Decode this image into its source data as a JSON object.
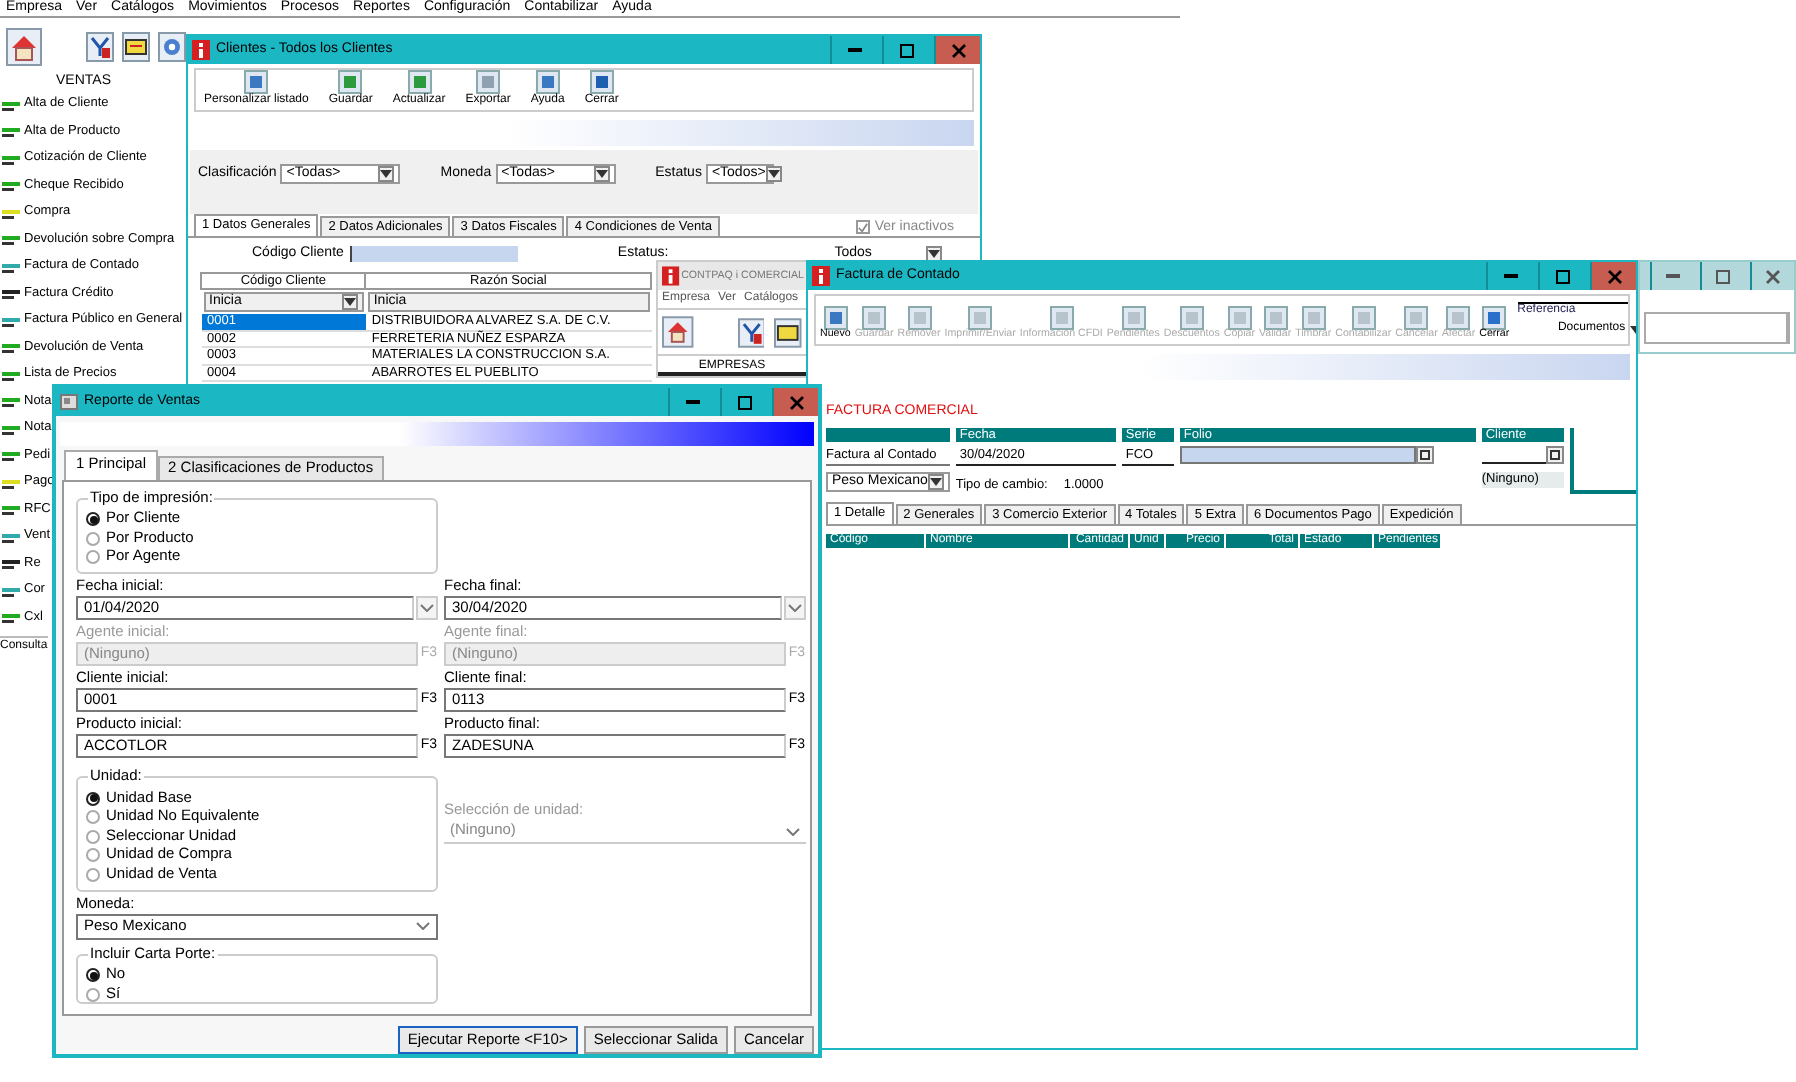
{
  "menu_bar": [
    "Empresa",
    "Ver",
    "Catálogos",
    "Movimientos",
    "Procesos",
    "Reportes",
    "Configuración",
    "Contabilizar",
    "Ayuda"
  ],
  "sidebar": {
    "title": "VENTAS",
    "items": [
      "Alta de Cliente",
      "Alta de Producto",
      "Cotización de Cliente",
      "Cheque Recibido",
      "Compra",
      "Devolución sobre Compra",
      "Factura de Contado",
      "Factura Crédito",
      "Factura Público en General",
      "Devolución de Venta",
      "Lista de Precios",
      "Nota",
      "Nota",
      "Pedi",
      "Pago",
      "RFC",
      "Vent",
      "Re",
      "Cor",
      "Cxl"
    ],
    "footer": "Consulta"
  },
  "clientes_window": {
    "title": "Clientes - Todos los Clientes",
    "toolbar": [
      "Personalizar listado",
      "Guardar",
      "Actualizar",
      "Exportar",
      "Ayuda",
      "Cerrar"
    ],
    "filters": [
      {
        "label": "Clasificación",
        "value": "<Todas>"
      },
      {
        "label": "Moneda",
        "value": "<Todas>"
      },
      {
        "label": "Estatus",
        "value": "<Todos>"
      }
    ],
    "tabs": [
      {
        "label": "1 Datos Generales",
        "selected": true
      },
      {
        "label": "2 Datos Adicionales",
        "selected": false
      },
      {
        "label": "3 Datos Fiscales",
        "selected": false
      },
      {
        "label": "4 Condiciones de Venta",
        "selected": false
      }
    ],
    "code_label": "Código Cliente",
    "status_label": "Estatus:",
    "status_value": "Todos",
    "inactive": {
      "label": "Ver inactivos",
      "checked": true
    },
    "table": {
      "columns": [
        "Código Cliente",
        "Razón Social"
      ],
      "filters": [
        "Inicia",
        "Inicia"
      ],
      "rows": [
        {
          "cells": [
            "0001",
            "DISTRIBUIDORA ALVAREZ S.A. DE C.V."
          ],
          "selected": true
        },
        {
          "cells": [
            "0002",
            "FERRETERIA NUÑEZ ESPARZA"
          ],
          "selected": false
        },
        {
          "cells": [
            "0003",
            "MATERIALES LA CONSTRUCCION S.A."
          ],
          "selected": false
        },
        {
          "cells": [
            "0004",
            "ABARROTES EL PUEBLITO"
          ],
          "selected": false
        }
      ]
    }
  },
  "contpaq_window": {
    "title": "CONTPAQ i COMERCIAL",
    "menu": [
      "Empresa",
      "Ver",
      "Catálogos"
    ],
    "label": "EMPRESAS"
  },
  "factura_window": {
    "title": "Factura de Contado",
    "toolbar": [
      {
        "label": "Nuevo",
        "disabled": false
      },
      {
        "label": "Guardar",
        "disabled": true
      },
      {
        "label": "Remover",
        "disabled": true
      },
      {
        "label": "Imprimir/Enviar",
        "disabled": true
      },
      {
        "label": "Información CFDI",
        "disabled": true
      },
      {
        "label": "Pendientes",
        "disabled": true
      },
      {
        "label": "Descuentos",
        "disabled": true
      },
      {
        "label": "Copiar",
        "disabled": true
      },
      {
        "label": "Validar",
        "disabled": true
      },
      {
        "label": "Timbrar",
        "disabled": true
      },
      {
        "label": "Contabilizar",
        "disabled": true
      },
      {
        "label": "Cancelar",
        "disabled": true
      },
      {
        "label": "Afectar",
        "disabled": true
      },
      {
        "label": "Cerrar",
        "disabled": false
      }
    ],
    "reference_label": "Referencia",
    "view_menu": "Documentos",
    "heading": "FACTURA COMERCIAL",
    "concept_value": "Factura al Contado",
    "date_label": "Fecha",
    "date_value": "30/04/2020",
    "series_label": "Serie",
    "series_value": "FCO",
    "folio_label": "Folio",
    "client_label": "Cliente",
    "client_name": "(Ninguno)",
    "currency_value": "Peso Mexicano",
    "rate_label": "Tipo de cambio:",
    "rate_value": "1.0000",
    "tabs": [
      {
        "label": "1 Detalle",
        "selected": true
      },
      {
        "label": "2 Generales",
        "selected": false
      },
      {
        "label": "3 Comercio Exterior",
        "selected": false
      },
      {
        "label": "4 Totales",
        "selected": false
      },
      {
        "label": "5 Extra",
        "selected": false
      },
      {
        "label": "6 Documentos Pago",
        "selected": false
      },
      {
        "label": "Expedición",
        "selected": false
      }
    ],
    "columns": [
      "Código",
      "Nombre",
      "Cantidad",
      "Unid",
      "Precio",
      "Total",
      "Estado",
      "Pendientes"
    ]
  },
  "reporte_window": {
    "title": "Reporte de Ventas",
    "tabs": [
      {
        "label": "1 Principal",
        "selected": true
      },
      {
        "label": "2 Clasificaciones de Productos",
        "selected": false
      }
    ],
    "print_type": {
      "title": "Tipo de impresión:",
      "options": [
        {
          "label": "Por Cliente",
          "selected": true
        },
        {
          "label": "Por Producto",
          "selected": false
        },
        {
          "label": "Por Agente",
          "selected": false
        }
      ]
    },
    "fields": [
      {
        "label": "Fecha inicial:",
        "value": "01/04/2020",
        "kind": "date",
        "disabled": false
      },
      {
        "label": "Fecha final:",
        "value": "30/04/2020",
        "kind": "date",
        "disabled": false
      },
      {
        "label": "Agente inicial:",
        "value": "(Ninguno)",
        "kind": "lookup",
        "key": "F3",
        "disabled": true
      },
      {
        "label": "Agente final:",
        "value": "(Ninguno)",
        "kind": "lookup",
        "key": "F3",
        "disabled": true
      },
      {
        "label": "Cliente inicial:",
        "value": "0001",
        "kind": "lookup",
        "key": "F3",
        "disabled": false
      },
      {
        "label": "Cliente final:",
        "value": "0113",
        "kind": "lookup",
        "key": "F3",
        "disabled": false
      },
      {
        "label": "Producto inicial:",
        "value": "ACCOTLOR",
        "kind": "lookup",
        "key": "F3",
        "disabled": false
      },
      {
        "label": "Producto final:",
        "value": "ZADESUNA",
        "kind": "lookup",
        "key": "F3",
        "disabled": false
      }
    ],
    "unit": {
      "title": "Unidad:",
      "options": [
        {
          "label": "Unidad Base",
          "selected": true
        },
        {
          "label": "Unidad No Equivalente",
          "selected": false
        },
        {
          "label": "Seleccionar Unidad",
          "selected": false
        },
        {
          "label": "Unidad de Compra",
          "selected": false
        },
        {
          "label": "Unidad de Venta",
          "selected": false
        }
      ]
    },
    "unit_select": {
      "label": "Selección de unidad:",
      "value": "(Ninguno)",
      "disabled": true
    },
    "currency": {
      "label": "Moneda:",
      "value": "Peso Mexicano"
    },
    "carta_porte": {
      "title": "Incluir Carta Porte:",
      "options": [
        {
          "label": "No",
          "selected": true
        },
        {
          "label": "Sí",
          "selected": false
        }
      ]
    },
    "buttons": [
      "Ejecutar Reporte <F10>",
      "Seleccionar Salida",
      "Cancelar"
    ]
  }
}
